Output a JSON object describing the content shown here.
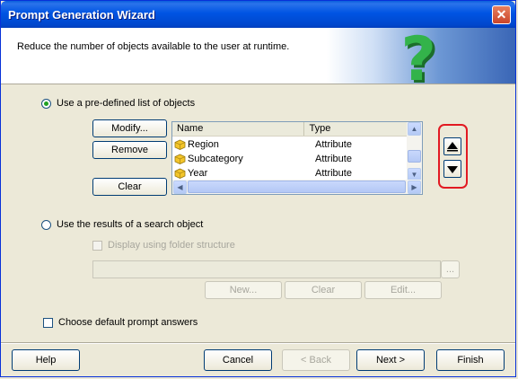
{
  "window": {
    "title": "Prompt Generation Wizard",
    "close_glyph": "✕"
  },
  "header": {
    "description": "Reduce the number of objects available to the user at runtime."
  },
  "option1": {
    "label": "Use a pre-defined list of objects",
    "checked": true
  },
  "buttons_left": {
    "modify": "Modify...",
    "remove": "Remove",
    "clear": "Clear"
  },
  "list": {
    "columns": [
      "Name",
      "Type"
    ],
    "rows": [
      {
        "name": "Region",
        "type": "Attribute",
        "icon": "attribute-icon"
      },
      {
        "name": "Subcategory",
        "type": "Attribute",
        "icon": "attribute-icon"
      },
      {
        "name": "Year",
        "type": "Attribute",
        "icon": "attribute-icon"
      }
    ]
  },
  "move": {
    "up_icon": "move-up-icon",
    "down_icon": "move-down-icon"
  },
  "option2": {
    "label": "Use the results of a search object",
    "checked": false,
    "display_folder_label": "Display using folder structure",
    "browse_label": "...",
    "new_label": "New...",
    "clear_label": "Clear",
    "edit_label": "Edit..."
  },
  "default_answers": {
    "label": "Choose default prompt answers",
    "checked": false
  },
  "footer": {
    "help": "Help",
    "cancel": "Cancel",
    "back": "< Back",
    "next": "Next >",
    "finish": "Finish"
  },
  "colors": {
    "title_bar": "#0054e3",
    "highlight_box": "#e21a22",
    "question_mark": "#33b34a"
  }
}
